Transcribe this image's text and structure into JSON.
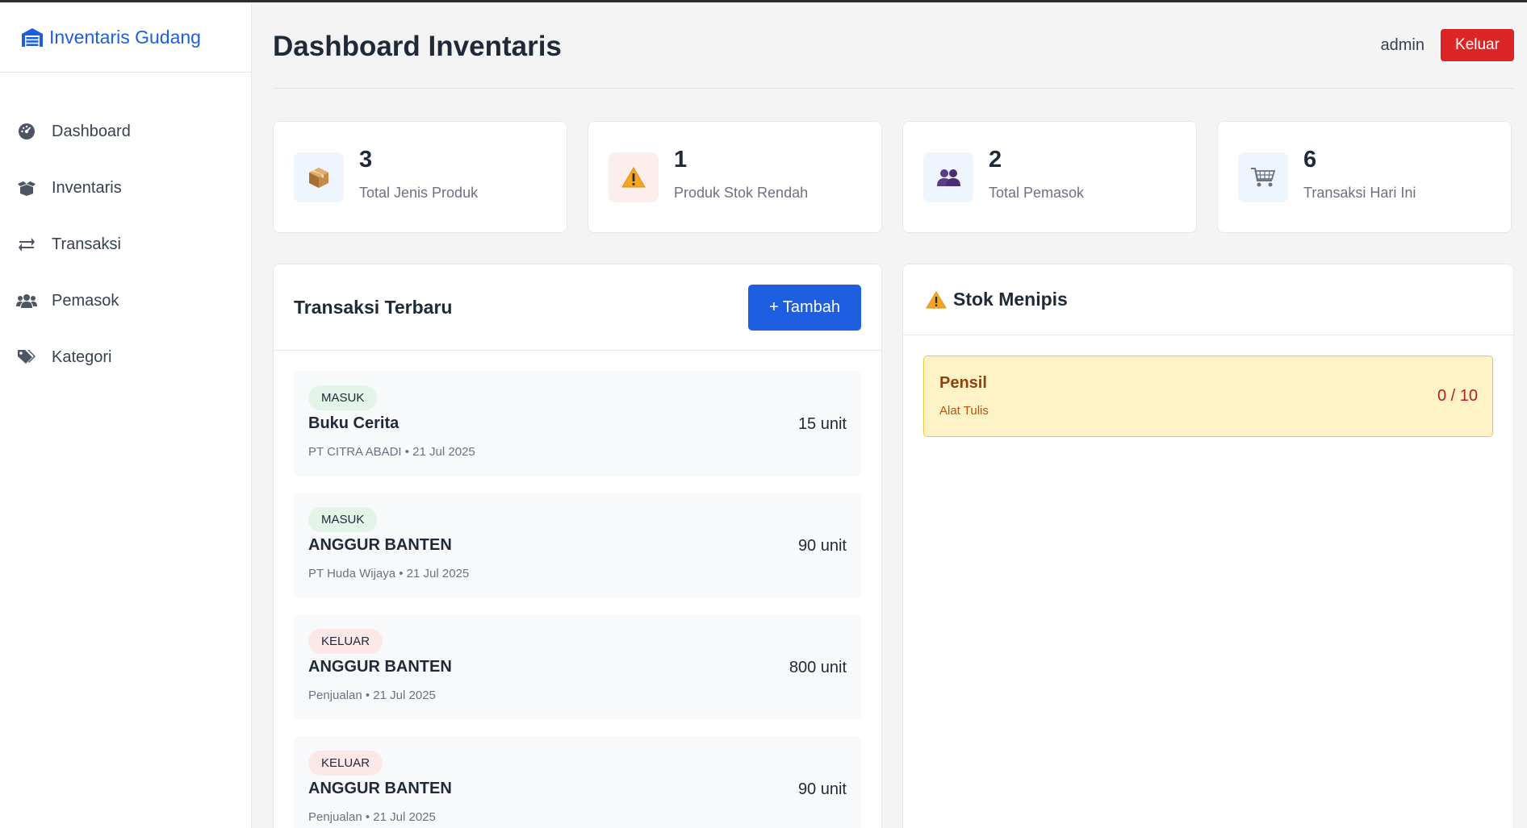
{
  "app": {
    "brand": "Inventaris Gudang"
  },
  "sidebar": {
    "items": [
      {
        "label": "Dashboard",
        "icon": "gauge-icon"
      },
      {
        "label": "Inventaris",
        "icon": "boxes-icon"
      },
      {
        "label": "Transaksi",
        "icon": "exchange-icon"
      },
      {
        "label": "Pemasok",
        "icon": "users-icon"
      },
      {
        "label": "Kategori",
        "icon": "tags-icon"
      }
    ]
  },
  "header": {
    "title": "Dashboard Inventaris",
    "user": "admin",
    "logout_label": "Keluar"
  },
  "stats": [
    {
      "value": "3",
      "label": "Total Jenis Produk",
      "icon": "package-icon"
    },
    {
      "value": "1",
      "label": "Produk Stok Rendah",
      "icon": "warning-icon"
    },
    {
      "value": "2",
      "label": "Total Pemasok",
      "icon": "people-icon"
    },
    {
      "value": "6",
      "label": "Transaksi Hari Ini",
      "icon": "cart-icon"
    }
  ],
  "transactions": {
    "title": "Transaksi Terbaru",
    "add_label": "+ Tambah",
    "items": [
      {
        "type": "MASUK",
        "name": "Buku Cerita",
        "meta": "PT CITRA ABADI • 21 Jul 2025",
        "qty": "15 unit"
      },
      {
        "type": "MASUK",
        "name": "ANGGUR BANTEN",
        "meta": "PT Huda Wijaya • 21 Jul 2025",
        "qty": "90 unit"
      },
      {
        "type": "KELUAR",
        "name": "ANGGUR BANTEN",
        "meta": "Penjualan • 21 Jul 2025",
        "qty": "800 unit"
      },
      {
        "type": "KELUAR",
        "name": "ANGGUR BANTEN",
        "meta": "Penjualan • 21 Jul 2025",
        "qty": "90 unit"
      }
    ]
  },
  "low_stock": {
    "title": "Stok Menipis",
    "items": [
      {
        "name": "Pensil",
        "category": "Alat Tulis",
        "qty": "0 / 10"
      }
    ]
  },
  "colors": {
    "primary": "#1d5fe0",
    "danger": "#dc2626",
    "warning_bg": "#fef3c7"
  }
}
